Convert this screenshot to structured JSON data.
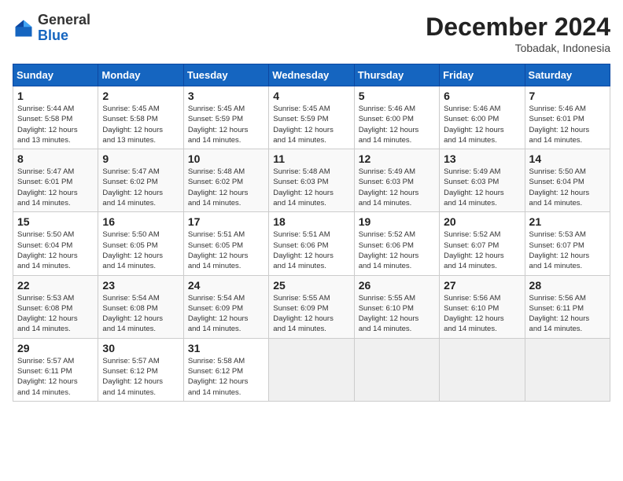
{
  "logo": {
    "general": "General",
    "blue": "Blue"
  },
  "header": {
    "month": "December 2024",
    "location": "Tobadak, Indonesia"
  },
  "weekdays": [
    "Sunday",
    "Monday",
    "Tuesday",
    "Wednesday",
    "Thursday",
    "Friday",
    "Saturday"
  ],
  "weeks": [
    [
      {
        "day": "1",
        "info": "Sunrise: 5:44 AM\nSunset: 5:58 PM\nDaylight: 12 hours\nand 13 minutes."
      },
      {
        "day": "2",
        "info": "Sunrise: 5:45 AM\nSunset: 5:58 PM\nDaylight: 12 hours\nand 13 minutes."
      },
      {
        "day": "3",
        "info": "Sunrise: 5:45 AM\nSunset: 5:59 PM\nDaylight: 12 hours\nand 14 minutes."
      },
      {
        "day": "4",
        "info": "Sunrise: 5:45 AM\nSunset: 5:59 PM\nDaylight: 12 hours\nand 14 minutes."
      },
      {
        "day": "5",
        "info": "Sunrise: 5:46 AM\nSunset: 6:00 PM\nDaylight: 12 hours\nand 14 minutes."
      },
      {
        "day": "6",
        "info": "Sunrise: 5:46 AM\nSunset: 6:00 PM\nDaylight: 12 hours\nand 14 minutes."
      },
      {
        "day": "7",
        "info": "Sunrise: 5:46 AM\nSunset: 6:01 PM\nDaylight: 12 hours\nand 14 minutes."
      }
    ],
    [
      {
        "day": "8",
        "info": "Sunrise: 5:47 AM\nSunset: 6:01 PM\nDaylight: 12 hours\nand 14 minutes."
      },
      {
        "day": "9",
        "info": "Sunrise: 5:47 AM\nSunset: 6:02 PM\nDaylight: 12 hours\nand 14 minutes."
      },
      {
        "day": "10",
        "info": "Sunrise: 5:48 AM\nSunset: 6:02 PM\nDaylight: 12 hours\nand 14 minutes."
      },
      {
        "day": "11",
        "info": "Sunrise: 5:48 AM\nSunset: 6:03 PM\nDaylight: 12 hours\nand 14 minutes."
      },
      {
        "day": "12",
        "info": "Sunrise: 5:49 AM\nSunset: 6:03 PM\nDaylight: 12 hours\nand 14 minutes."
      },
      {
        "day": "13",
        "info": "Sunrise: 5:49 AM\nSunset: 6:03 PM\nDaylight: 12 hours\nand 14 minutes."
      },
      {
        "day": "14",
        "info": "Sunrise: 5:50 AM\nSunset: 6:04 PM\nDaylight: 12 hours\nand 14 minutes."
      }
    ],
    [
      {
        "day": "15",
        "info": "Sunrise: 5:50 AM\nSunset: 6:04 PM\nDaylight: 12 hours\nand 14 minutes."
      },
      {
        "day": "16",
        "info": "Sunrise: 5:50 AM\nSunset: 6:05 PM\nDaylight: 12 hours\nand 14 minutes."
      },
      {
        "day": "17",
        "info": "Sunrise: 5:51 AM\nSunset: 6:05 PM\nDaylight: 12 hours\nand 14 minutes."
      },
      {
        "day": "18",
        "info": "Sunrise: 5:51 AM\nSunset: 6:06 PM\nDaylight: 12 hours\nand 14 minutes."
      },
      {
        "day": "19",
        "info": "Sunrise: 5:52 AM\nSunset: 6:06 PM\nDaylight: 12 hours\nand 14 minutes."
      },
      {
        "day": "20",
        "info": "Sunrise: 5:52 AM\nSunset: 6:07 PM\nDaylight: 12 hours\nand 14 minutes."
      },
      {
        "day": "21",
        "info": "Sunrise: 5:53 AM\nSunset: 6:07 PM\nDaylight: 12 hours\nand 14 minutes."
      }
    ],
    [
      {
        "day": "22",
        "info": "Sunrise: 5:53 AM\nSunset: 6:08 PM\nDaylight: 12 hours\nand 14 minutes."
      },
      {
        "day": "23",
        "info": "Sunrise: 5:54 AM\nSunset: 6:08 PM\nDaylight: 12 hours\nand 14 minutes."
      },
      {
        "day": "24",
        "info": "Sunrise: 5:54 AM\nSunset: 6:09 PM\nDaylight: 12 hours\nand 14 minutes."
      },
      {
        "day": "25",
        "info": "Sunrise: 5:55 AM\nSunset: 6:09 PM\nDaylight: 12 hours\nand 14 minutes."
      },
      {
        "day": "26",
        "info": "Sunrise: 5:55 AM\nSunset: 6:10 PM\nDaylight: 12 hours\nand 14 minutes."
      },
      {
        "day": "27",
        "info": "Sunrise: 5:56 AM\nSunset: 6:10 PM\nDaylight: 12 hours\nand 14 minutes."
      },
      {
        "day": "28",
        "info": "Sunrise: 5:56 AM\nSunset: 6:11 PM\nDaylight: 12 hours\nand 14 minutes."
      }
    ],
    [
      {
        "day": "29",
        "info": "Sunrise: 5:57 AM\nSunset: 6:11 PM\nDaylight: 12 hours\nand 14 minutes."
      },
      {
        "day": "30",
        "info": "Sunrise: 5:57 AM\nSunset: 6:12 PM\nDaylight: 12 hours\nand 14 minutes."
      },
      {
        "day": "31",
        "info": "Sunrise: 5:58 AM\nSunset: 6:12 PM\nDaylight: 12 hours\nand 14 minutes."
      },
      null,
      null,
      null,
      null
    ]
  ]
}
